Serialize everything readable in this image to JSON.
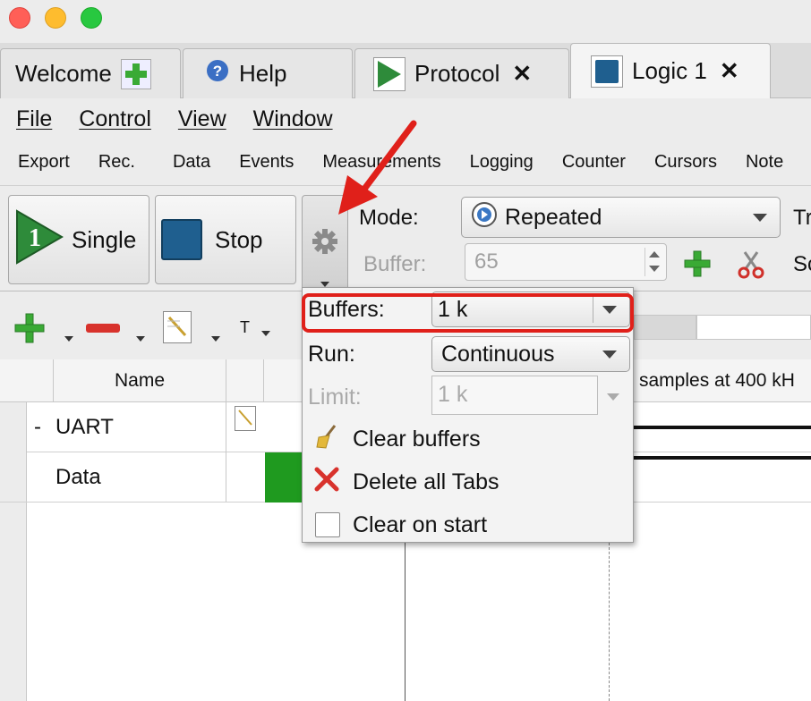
{
  "tabs": [
    {
      "label": "Welcome",
      "icon": "plus-icon"
    },
    {
      "label": "Help",
      "icon": "help-icon"
    },
    {
      "label": "Protocol",
      "icon": "play-icon"
    },
    {
      "label": "Logic 1",
      "icon": "stop-square-icon",
      "active": true
    }
  ],
  "menu": [
    "File",
    "Control",
    "View",
    "Window"
  ],
  "subtoolbar": [
    "Export",
    "Rec.",
    "Data",
    "Events",
    "Measurements",
    "Logging",
    "Counter",
    "Cursors",
    "Note"
  ],
  "controls": {
    "single_label": "Single",
    "single_icon_text": "1",
    "stop_label": "Stop",
    "mode_label": "Mode:",
    "mode_value": "Repeated",
    "buffer_label": "Buffer:",
    "buffer_value": "65",
    "cut_right_1": "Tr",
    "cut_right_2": "Sc"
  },
  "table": {
    "columns": [
      "Name"
    ],
    "rows": [
      {
        "prefix": "-",
        "name": "UART"
      },
      {
        "prefix": "",
        "name": "Data"
      }
    ],
    "samples_text": "samples at 400 kH",
    "tool_t": "T"
  },
  "popup": {
    "buffers_label": "Buffers:",
    "buffers_value": "1 k",
    "run_label": "Run:",
    "run_value": "Continuous",
    "limit_label": "Limit:",
    "limit_value": "1 k",
    "clear_buffers": "Clear buffers",
    "delete_tabs": "Delete all Tabs",
    "clear_on_start": "Clear on start"
  },
  "colors": {
    "highlight": "#e0201a",
    "green_play": "#2e8b3a",
    "stop_blue": "#1f5f8f",
    "data_green": "#2a9a2a"
  }
}
